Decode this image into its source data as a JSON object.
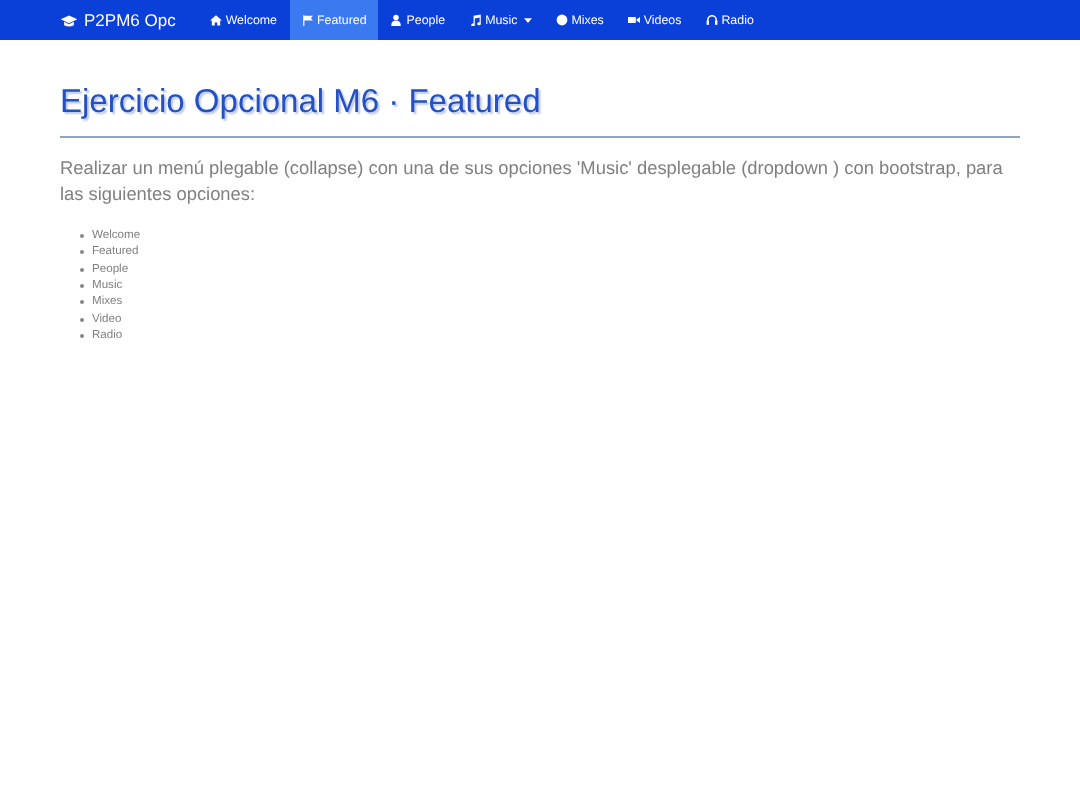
{
  "navbar": {
    "brand": "P2PM6 Opc",
    "items": [
      {
        "label": "Welcome",
        "selected": false,
        "dropdown": false
      },
      {
        "label": "Featured",
        "selected": true,
        "dropdown": false
      },
      {
        "label": "People",
        "selected": false,
        "dropdown": false
      },
      {
        "label": "Music",
        "selected": false,
        "dropdown": true
      },
      {
        "label": "Mixes",
        "selected": false,
        "dropdown": false
      },
      {
        "label": "Videos",
        "selected": false,
        "dropdown": false
      },
      {
        "label": "Radio",
        "selected": false,
        "dropdown": false
      }
    ]
  },
  "heading": "Ejercicio Opcional M6 · Featured",
  "description": "Realizar un menú plegable (collapse) con una de sus opciones 'Music' desplegable (dropdown ) con bootstrap, para las siguientes opciones:",
  "options": [
    "Welcome",
    "Featured",
    "People",
    "Music",
    "Mixes",
    "Video",
    "Radio"
  ]
}
